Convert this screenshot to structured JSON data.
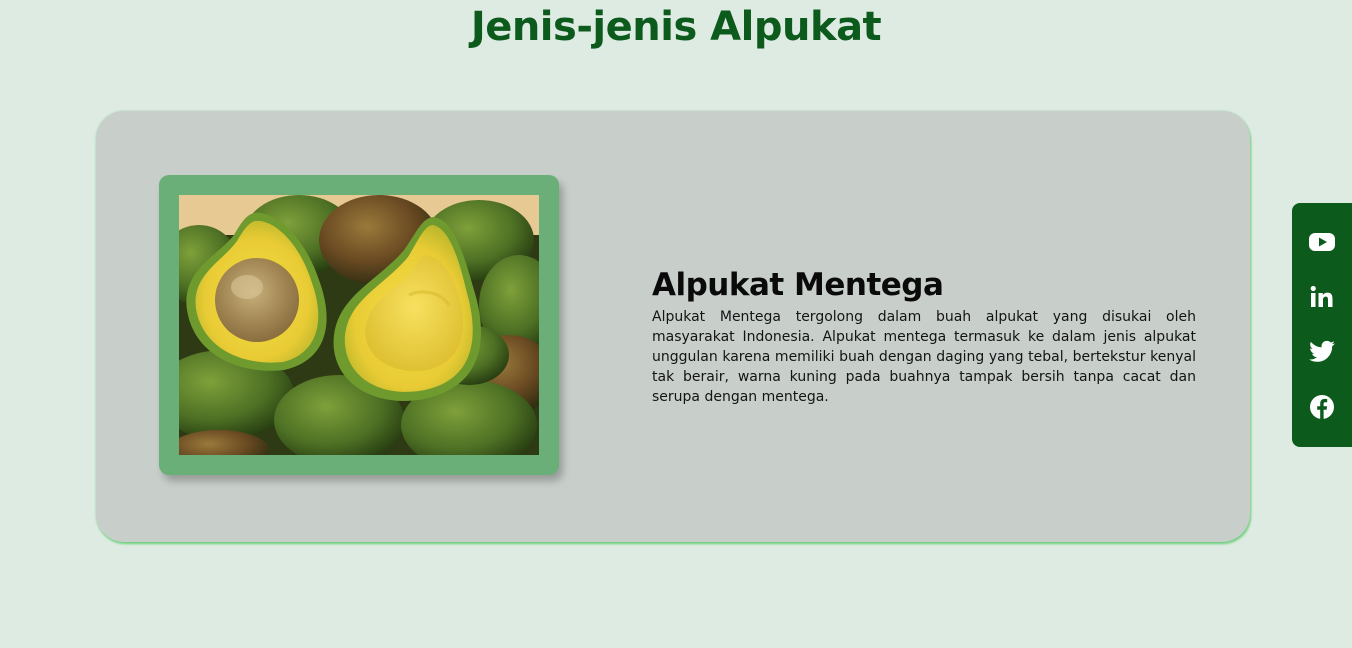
{
  "page": {
    "title": "Jenis-jenis Alpukat"
  },
  "card": {
    "image_alt": "Alpukat Mentega",
    "title": "Alpukat Mentega",
    "description": "Alpukat Mentega tergolong dalam buah alpukat yang disukai oleh masyarakat Indonesia. Alpukat mentega termasuk ke dalam jenis alpukat unggulan karena memiliki buah dengan daging yang tebal, bertekstur kenyal tak berair, warna kuning pada buahnya tampak bersih tanpa cacat dan serupa dengan mentega."
  },
  "social": [
    {
      "icon": "youtube-icon"
    },
    {
      "icon": "linkedin-icon"
    },
    {
      "icon": "twitter-icon"
    },
    {
      "icon": "facebook-icon"
    }
  ],
  "colors": {
    "background": "#deebe3",
    "title": "#0d5a1d",
    "card": "#c8cfcb",
    "frame": "#6aaf78",
    "social_bar": "#0d5a1d"
  }
}
